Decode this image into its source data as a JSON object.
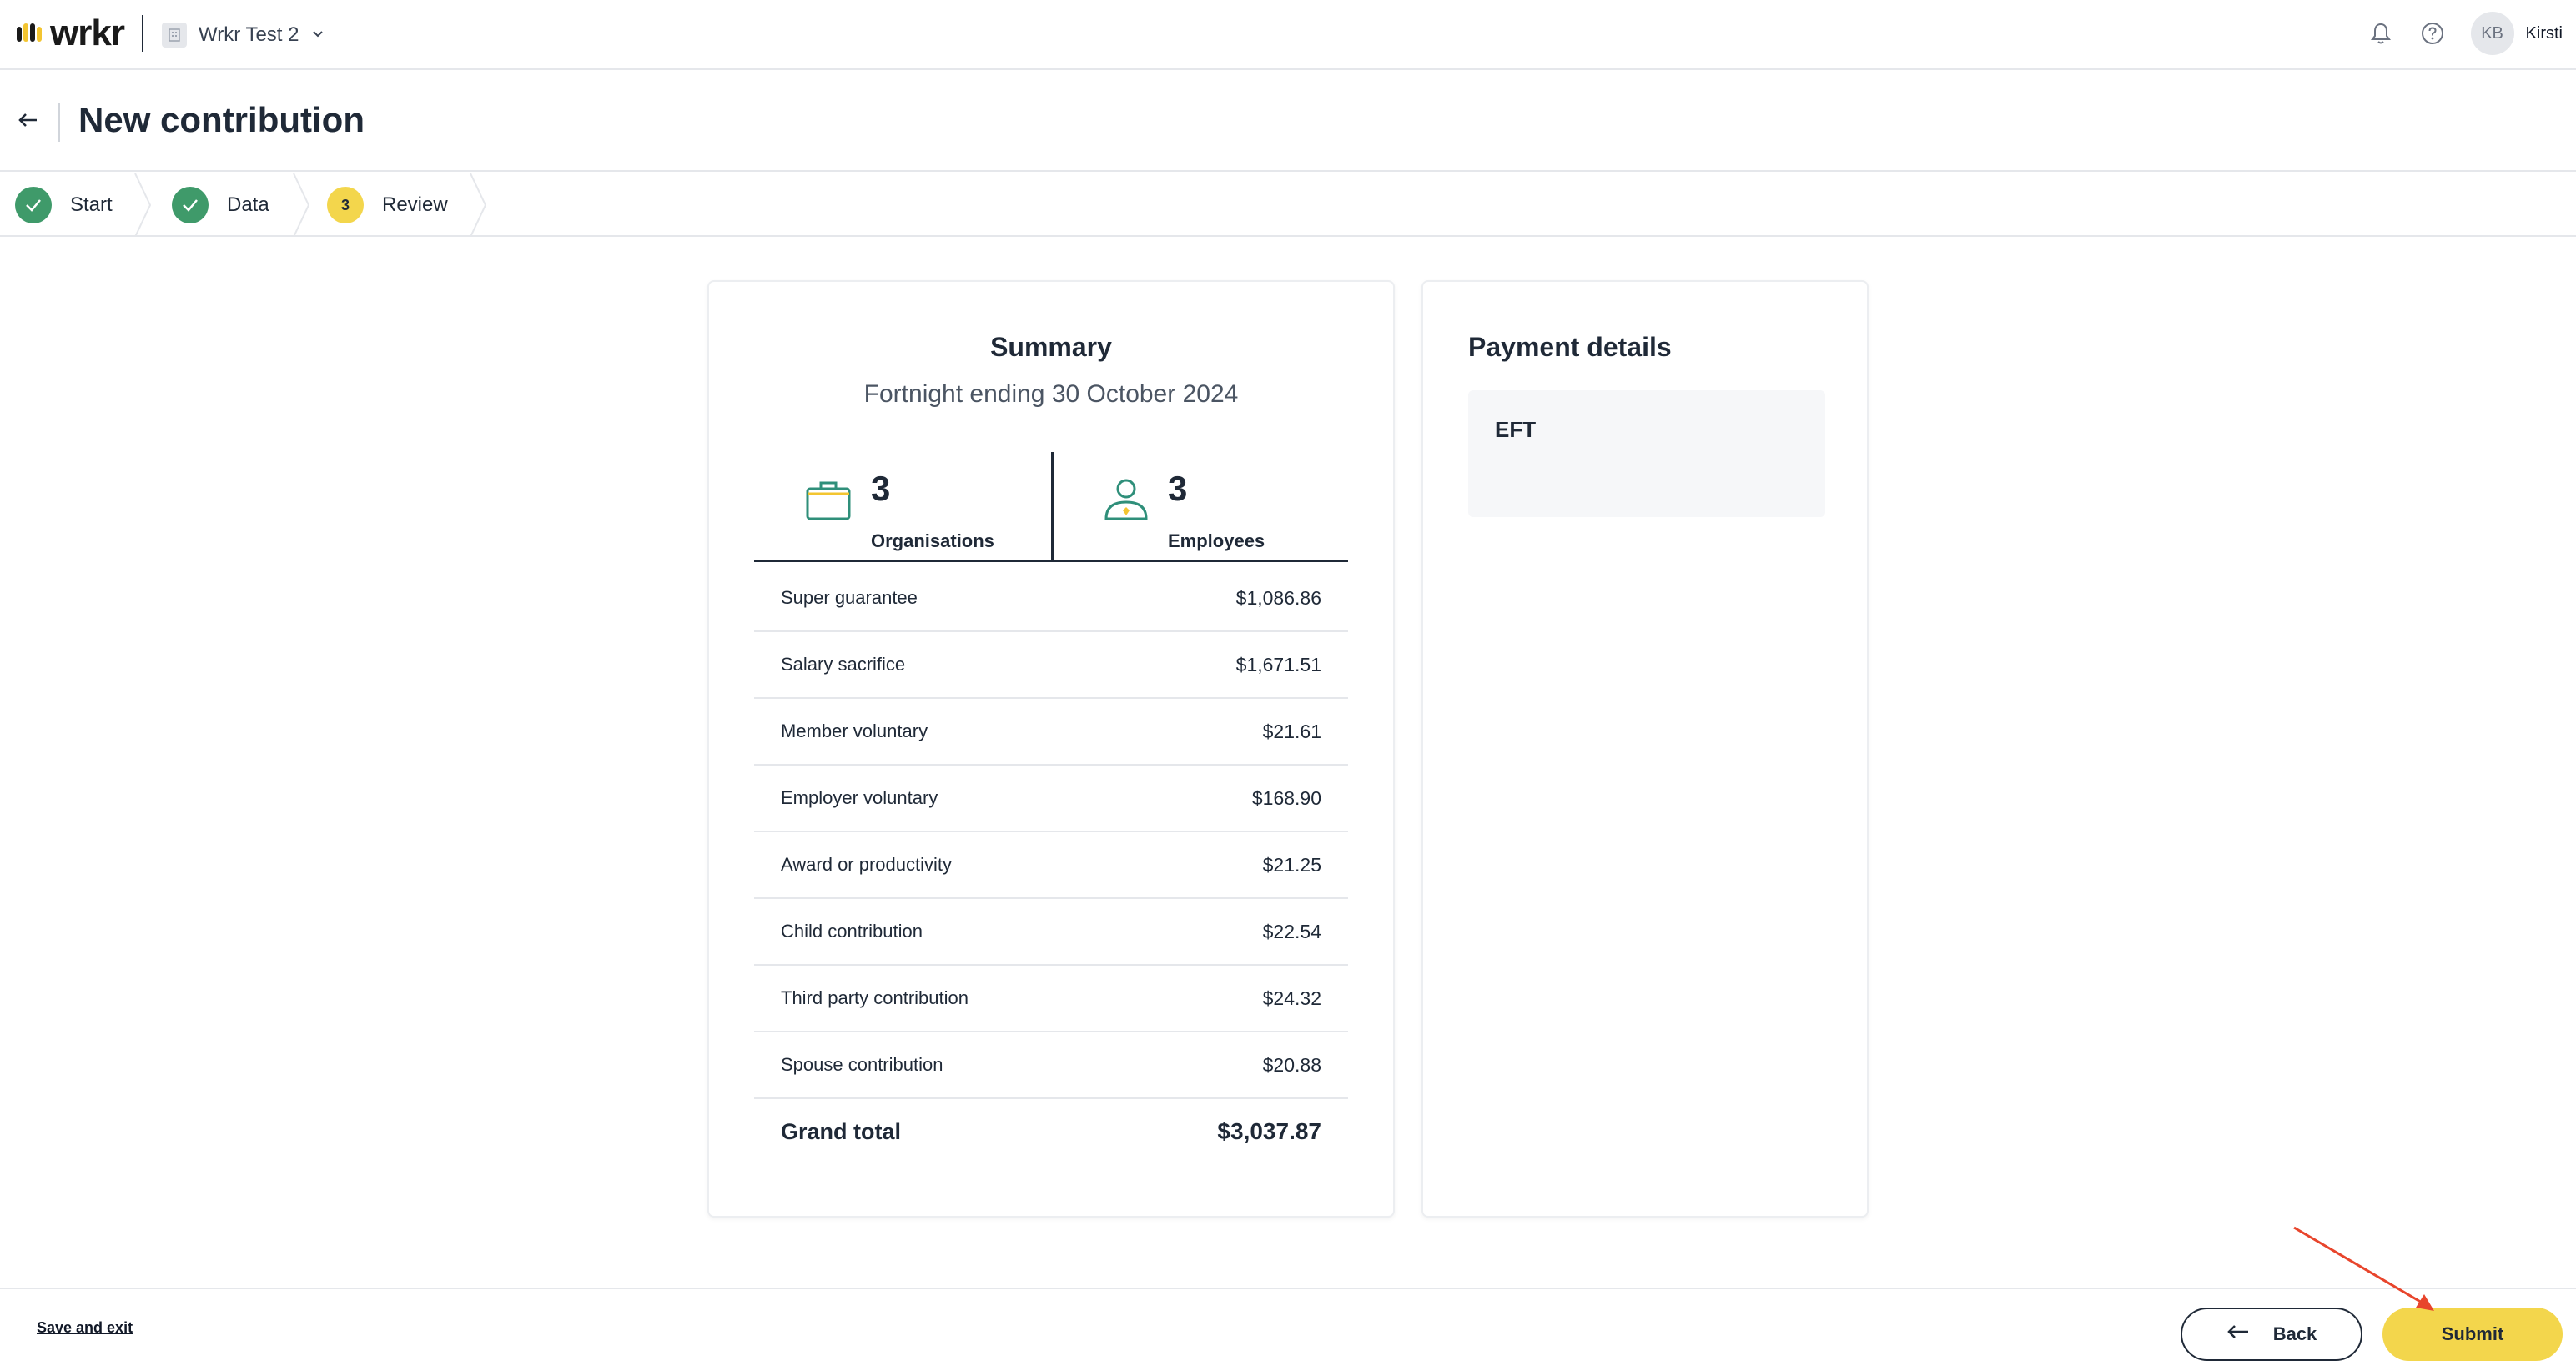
{
  "app": {
    "logo_text": "wrkr",
    "workspace_name": "Wrkr Test 2"
  },
  "user": {
    "initials": "KB",
    "name": "Kirsti"
  },
  "page": {
    "title": "New contribution"
  },
  "stepper": {
    "steps": [
      {
        "label": "Start",
        "state": "done"
      },
      {
        "label": "Data",
        "state": "done"
      },
      {
        "label": "Review",
        "state": "active",
        "number": "3"
      }
    ]
  },
  "summary": {
    "title": "Summary",
    "subtitle": "Fortnight ending 30 October 2024",
    "stats": {
      "organisations": {
        "count": "3",
        "label": "Organisations"
      },
      "employees": {
        "count": "3",
        "label": "Employees"
      }
    },
    "rows": [
      {
        "label": "Super guarantee",
        "amount": "$1,086.86"
      },
      {
        "label": "Salary sacrifice",
        "amount": "$1,671.51"
      },
      {
        "label": "Member voluntary",
        "amount": "$21.61"
      },
      {
        "label": "Employer voluntary",
        "amount": "$168.90"
      },
      {
        "label": "Award or productivity",
        "amount": "$21.25"
      },
      {
        "label": "Child contribution",
        "amount": "$22.54"
      },
      {
        "label": "Third party contribution",
        "amount": "$24.32"
      },
      {
        "label": "Spouse contribution",
        "amount": "$20.88"
      }
    ],
    "grand_total": {
      "label": "Grand total",
      "amount": "$3,037.87"
    }
  },
  "payment": {
    "title": "Payment details",
    "method": "EFT"
  },
  "footer": {
    "save_exit": "Save and exit",
    "back": "Back",
    "submit": "Submit"
  },
  "colors": {
    "accent_yellow": "#f3d64c",
    "success_green": "#3f9a6a",
    "icon_teal": "#2f8f7a",
    "annotation_red": "#e8452c"
  }
}
